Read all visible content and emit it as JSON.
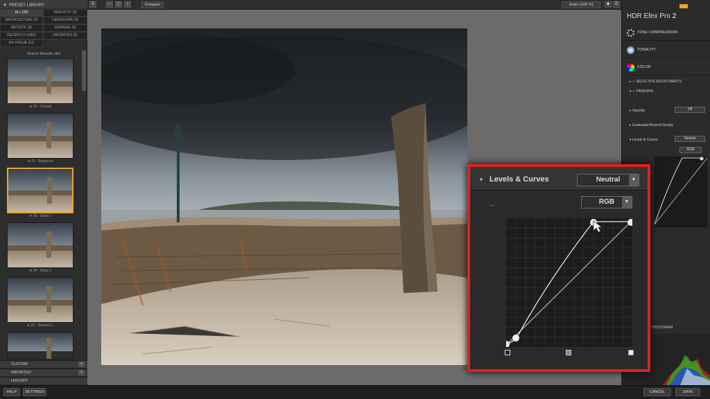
{
  "library": {
    "title": "PRESET LIBRARY",
    "filters": [
      {
        "label": "ALL (40)",
        "active": true
      },
      {
        "label": "REALISTIC (9)"
      },
      {
        "label": "ARCHITECTURE (4)"
      },
      {
        "label": "LANDSCAPE (4)"
      },
      {
        "label": "ARTISTIC (6)"
      },
      {
        "label": "SURREAL (5)"
      },
      {
        "label": "RECENTLY USED"
      },
      {
        "label": "FAVORITES (0)"
      },
      {
        "label": "EN VOGUE (12)"
      }
    ],
    "search_results": "Search Results (40)",
    "presets": [
      "★ 01 - Default",
      "★ 02 - Balanced",
      "★ 03 - Deep 1",
      "★ 04 - Deep 2",
      "★ 05 - Detailed 1"
    ],
    "footer": [
      "CUSTOM",
      "IMPORTED",
      "HISTORY"
    ]
  },
  "toolbar": {
    "compare": "Compare",
    "zoom": "Zoom (100 %)"
  },
  "bottom": {
    "help": "HELP",
    "settings": "SETTINGS",
    "cancel": "CANCEL",
    "save": "SAVE"
  },
  "right": {
    "app": "HDR Efex Pro",
    "version": "2",
    "sections": [
      "TONE COMPRESSION",
      "TONALITY",
      "COLOR"
    ],
    "collapsed": [
      "SELECTIVE ADJUSTMENTS",
      "FINISHING"
    ],
    "vignette": "Vignette",
    "vignette_val": "Off",
    "gnd": "Graduated Neutral Density",
    "levels": "Levels & Curves",
    "levels_val": "Neutral",
    "rgb": "RGB",
    "histogram": "HISTOGRAM"
  },
  "zoom": {
    "title": "Levels & Curves",
    "preset": "Neutral",
    "channel": "RGB",
    "dots": "..."
  },
  "colors": {
    "accent": "#e8a52a",
    "highlight_border": "#e02020"
  }
}
